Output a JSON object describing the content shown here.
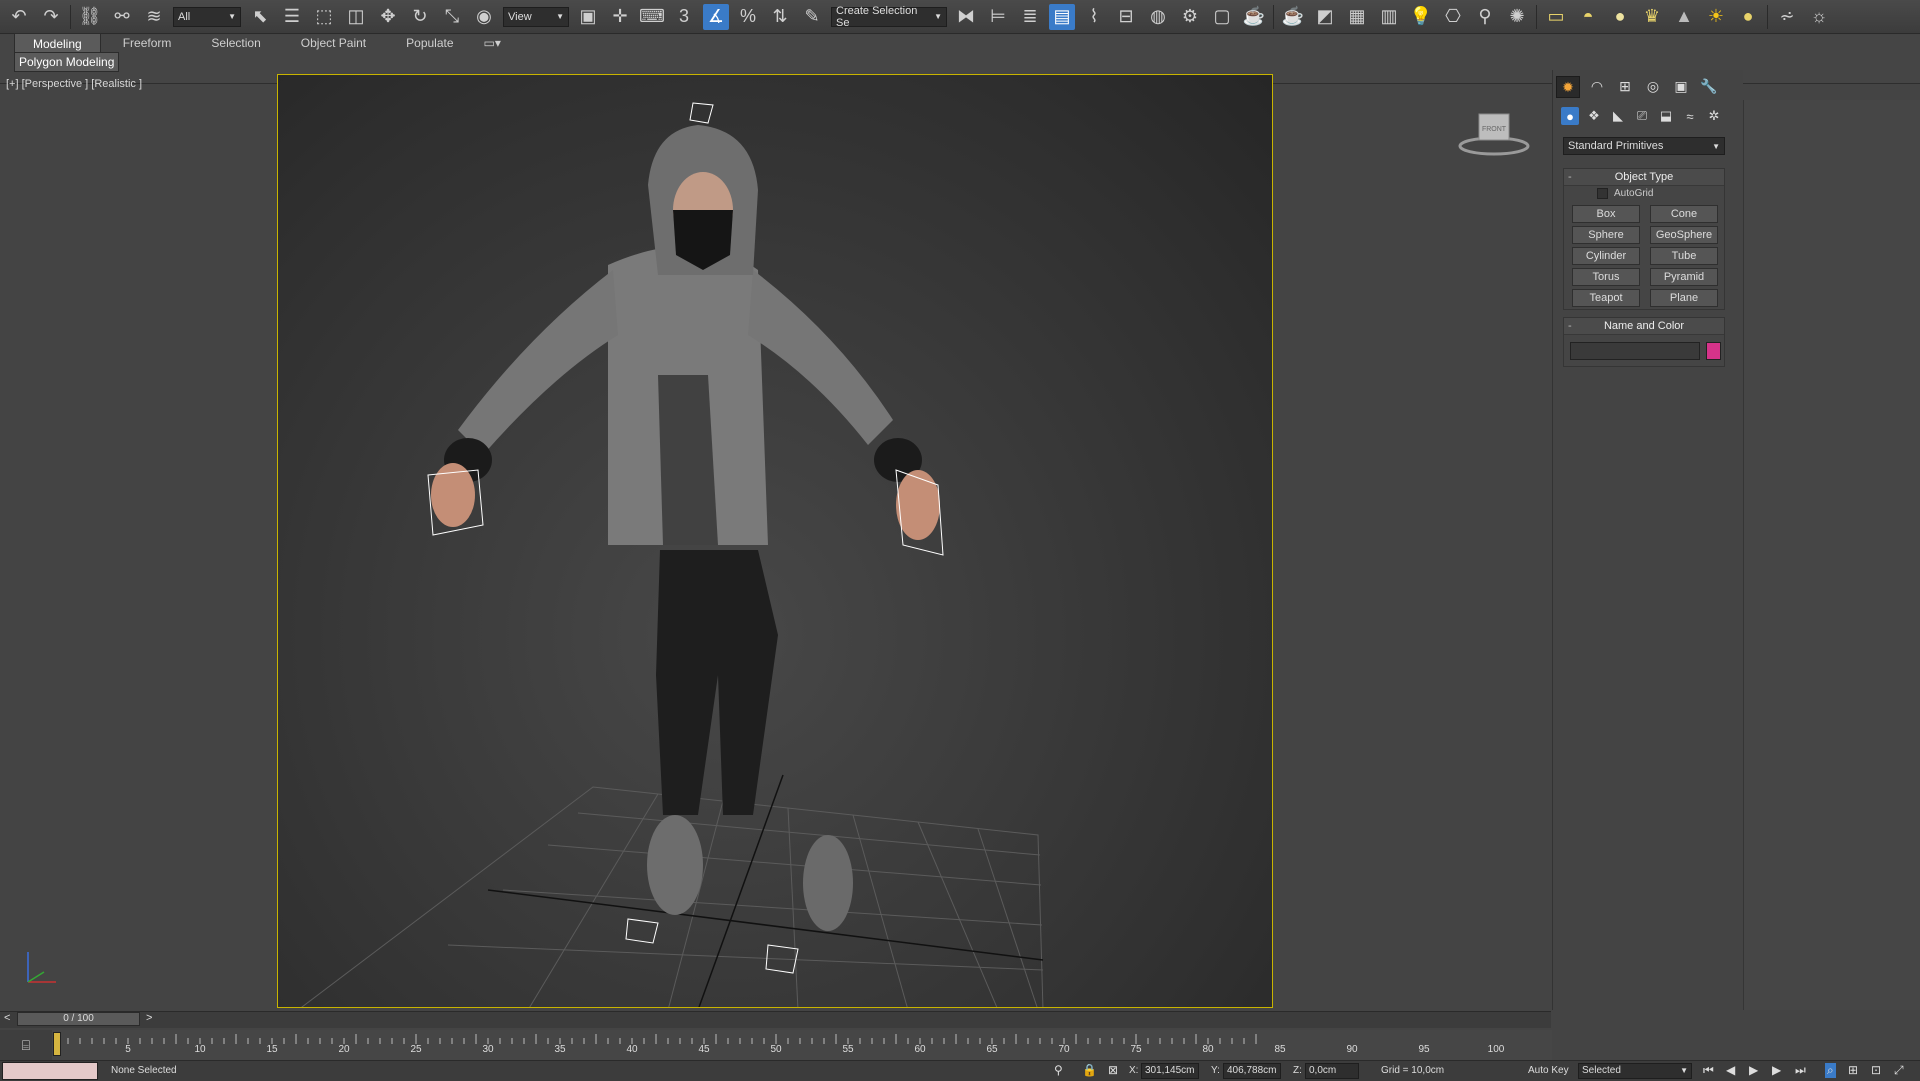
{
  "toolbar": {
    "selection_filter": "All",
    "reference_coord": "View",
    "named_selection_set": "Create Selection Se",
    "snap_label": "3",
    "colors": {
      "active": "#3a7bc8",
      "background": "#444444"
    }
  },
  "ribbon": {
    "tabs": [
      "Modeling",
      "Freeform",
      "Selection",
      "Object Paint",
      "Populate"
    ],
    "selected_tab": "Modeling",
    "subtab": "Polygon Modeling"
  },
  "viewport": {
    "label": "[+] [Perspective ] [Realistic ]",
    "viewcube_label": "FRONT",
    "active_border_color": "#c8b400"
  },
  "command_panel": {
    "primitive_type": "Standard Primitives",
    "object_type": {
      "title": "Object Type",
      "autogrid_label": "AutoGrid",
      "buttons": [
        "Box",
        "Cone",
        "Sphere",
        "GeoSphere",
        "Cylinder",
        "Tube",
        "Torus",
        "Pyramid",
        "Teapot",
        "Plane"
      ]
    },
    "name_and_color": {
      "title": "Name and Color",
      "name_value": "",
      "swatch_color": "#d6338a"
    }
  },
  "timeline": {
    "slider_text": "0 / 100",
    "prev": "<",
    "next": ">",
    "ticks": [
      "5",
      "10",
      "15",
      "20",
      "25",
      "30",
      "35",
      "40",
      "45",
      "50",
      "55",
      "60",
      "65",
      "70",
      "75",
      "80",
      "85",
      "90",
      "95",
      "100"
    ]
  },
  "status": {
    "selection": "None Selected",
    "x_label": "X:",
    "x_value": "301,145cm",
    "y_label": "Y:",
    "y_value": "406,788cm",
    "z_label": "Z:",
    "z_value": "0,0cm",
    "grid": "Grid = 10,0cm",
    "auto_key": "Auto Key",
    "key_filter": "Selected"
  }
}
